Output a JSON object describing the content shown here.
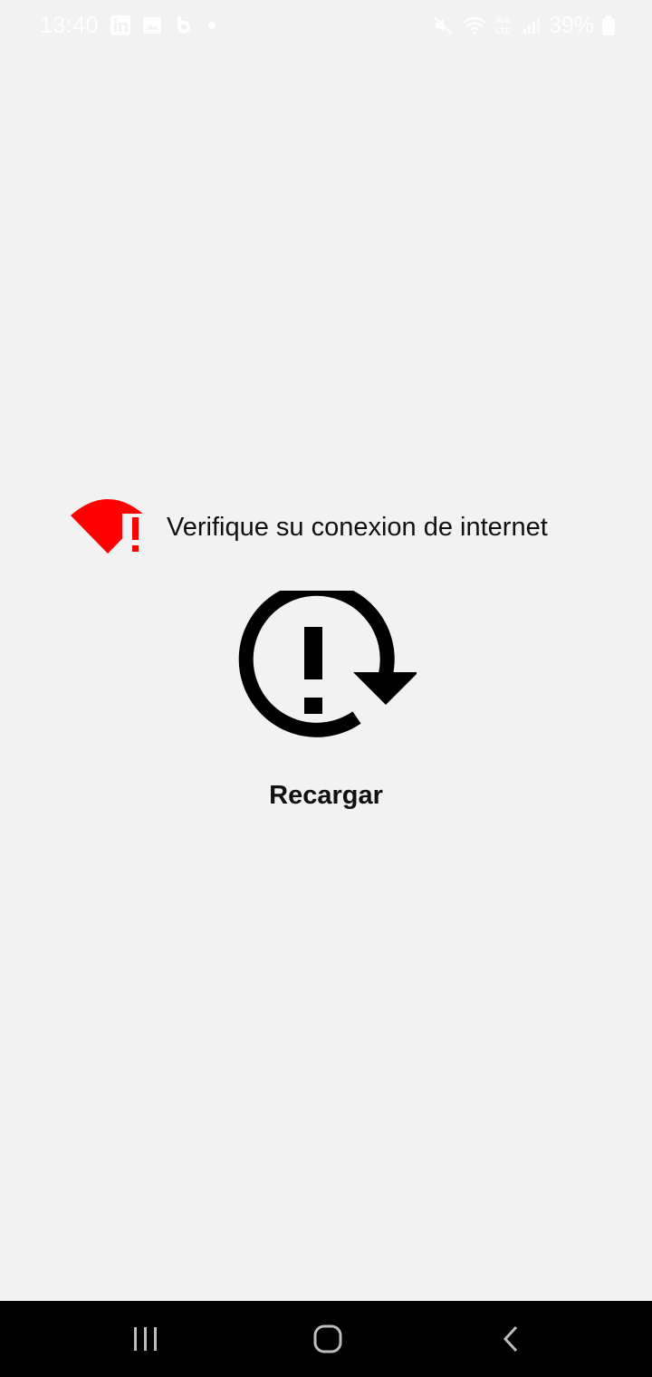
{
  "status_bar": {
    "time": "13:40",
    "battery_percent": "39%",
    "left_icons": [
      "linkedin-icon",
      "gallery-icon",
      "bumble-icon",
      "notification-dot-icon"
    ],
    "right_icons": [
      "mute-icon",
      "wifi-icon",
      "volte-icon",
      "signal-icon",
      "battery-icon"
    ]
  },
  "offline_message": {
    "text": "Verifique su conexion de internet",
    "icon": "wifi-off-alert-icon",
    "accent_color": "#ff0000"
  },
  "reload": {
    "label": "Recargar",
    "icon": "reload-alert-icon"
  },
  "navigation_bar": {
    "items": [
      "recents-button",
      "home-button",
      "back-button"
    ]
  }
}
